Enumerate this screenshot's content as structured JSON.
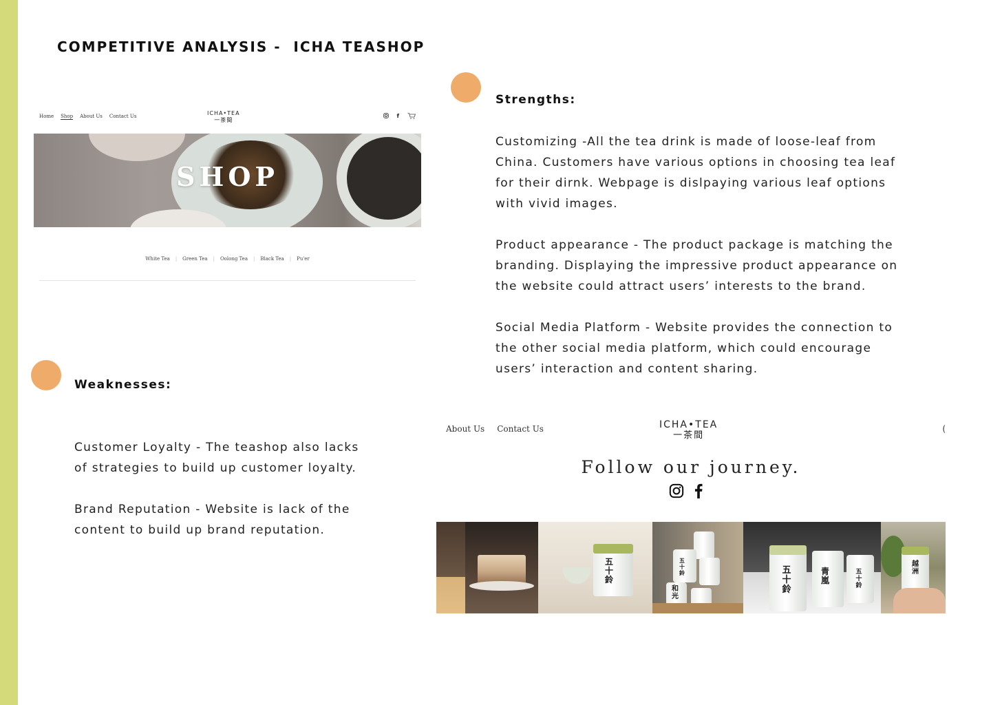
{
  "page": {
    "title": "COMPETITIVE ANALYSIS -  ICHA TEASHOP",
    "accent_stripe_color": "#d4da7a",
    "dot_color": "#efab6a"
  },
  "shop_screenshot": {
    "nav": [
      "Home",
      "Shop",
      "About Us",
      "Contact Us"
    ],
    "active_nav": "Shop",
    "logo": "ICHA•TEA",
    "logo_cn": "一茶間",
    "icons": [
      "instagram-icon",
      "facebook-icon",
      "cart-icon"
    ],
    "hero_text": "SHOP",
    "categories": [
      "White Tea",
      "Green Tea",
      "Oolong Tea",
      "Black Tea",
      "Pu'er"
    ]
  },
  "strengths": {
    "heading": "Strengths:",
    "paragraphs": [
      "Customizing -All the tea drink is made of loose-leaf from\nChina. Customers have various options in choosing tea leaf\nfor their dirnk.   Webpage is dislpaying various leaf options\nwith vivid images.",
      "Product appearance - The product package is matching the\nbranding. Displaying the impressive product appearance on\nthe website could attract users’ interests to the brand.",
      "Social Media Platform - Website provides the connection to\nthe other social media platform, which could encourage\nusers’ interaction and content sharing."
    ]
  },
  "weaknesses": {
    "heading": "Weaknesses:",
    "paragraphs": [
      "Customer Loyalty - The teashop also lacks\nof strategies to build up customer loyalty.",
      "Brand Reputation - Website is lack of the\ncontent to build up brand reputation."
    ]
  },
  "journey_screenshot": {
    "nav": [
      "About Us",
      "Contact Us"
    ],
    "logo": "ICHA•TEA",
    "logo_cn": "一茶間",
    "edge_glyph": "(",
    "follow_text": "Follow our journey.",
    "icons": [
      "instagram-icon",
      "facebook-icon"
    ],
    "photo_labels": [
      "五十鈴",
      "五十鈴",
      "和光",
      "青嵐",
      "五十鈴",
      "五十鈴",
      "越洲"
    ]
  }
}
